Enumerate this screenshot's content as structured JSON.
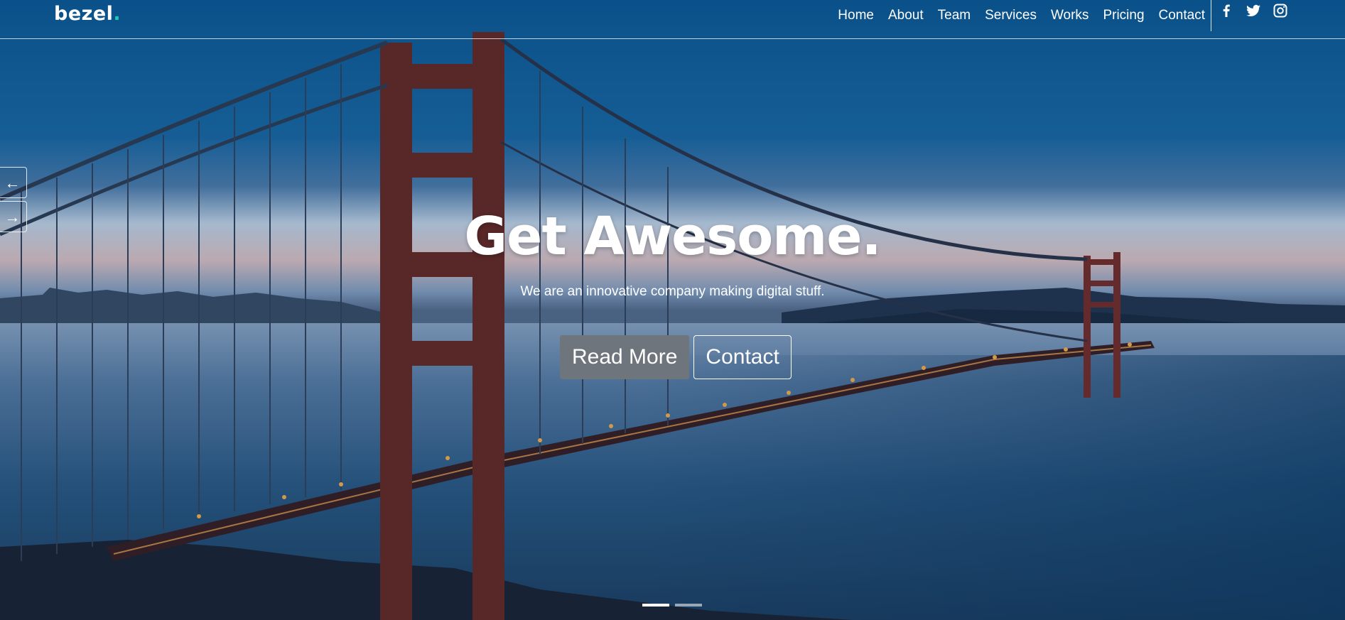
{
  "brand": {
    "name": "bezel",
    "dot": ".",
    "accent_color": "#1fc8b3"
  },
  "nav": {
    "items": [
      {
        "label": "Home"
      },
      {
        "label": "About"
      },
      {
        "label": "Team"
      },
      {
        "label": "Services"
      },
      {
        "label": "Works"
      },
      {
        "label": "Pricing"
      },
      {
        "label": "Contact"
      }
    ]
  },
  "social": [
    {
      "icon": "facebook-icon"
    },
    {
      "icon": "twitter-icon"
    },
    {
      "icon": "instagram-icon"
    }
  ],
  "carousel": {
    "prev_icon": "←",
    "next_icon": "→",
    "slide_count": 2,
    "active_slide": 1
  },
  "hero": {
    "headline": "Get Awesome.",
    "subheadline": "We are an innovative company making digital stuff.",
    "primary_button": "Read More",
    "secondary_button": "Contact",
    "primary_button_color": "#6f757d"
  }
}
